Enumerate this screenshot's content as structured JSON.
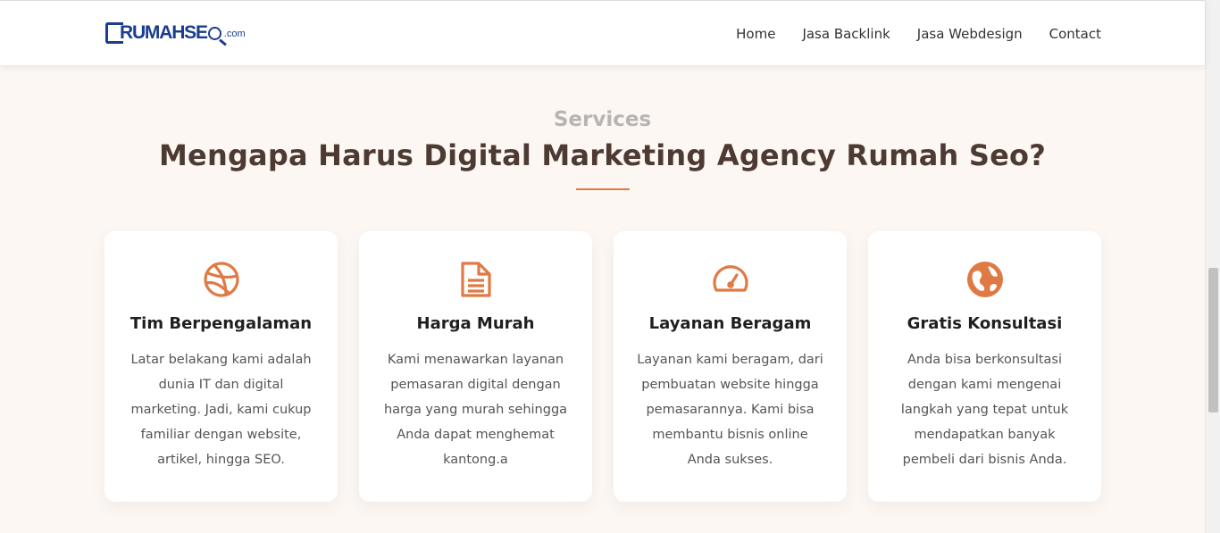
{
  "header": {
    "logo": {
      "main": "RUMAHSE",
      "suffix": ".com"
    },
    "nav": [
      {
        "label": "Home"
      },
      {
        "label": "Jasa Backlink"
      },
      {
        "label": "Jasa Webdesign"
      },
      {
        "label": "Contact"
      }
    ]
  },
  "section": {
    "kicker": "Services",
    "title": "Mengapa Harus Digital Marketing Agency Rumah Seo?"
  },
  "cards": [
    {
      "icon": "basketball-icon",
      "title": "Tim Berpengalaman",
      "text": "Latar belakang kami adalah dunia IT dan digital marketing. Jadi, kami cukup familiar dengan website, artikel, hingga SEO."
    },
    {
      "icon": "document-icon",
      "title": "Harga Murah",
      "text": "Kami menawarkan layanan pemasaran digital dengan harga yang murah sehingga Anda dapat menghemat kantong.a"
    },
    {
      "icon": "speedometer-icon",
      "title": "Layanan Beragam",
      "text": "Layanan kami beragam, dari pembuatan website hingga pemasarannya. Kami bisa membantu bisnis online Anda sukses."
    },
    {
      "icon": "globe-icon",
      "title": "Gratis Konsultasi",
      "text": "Anda bisa berkonsultasi dengan kami mengenai langkah yang tepat untuk mendapatkan banyak pembeli dari bisnis Anda."
    }
  ],
  "colors": {
    "accent": "#e07a45",
    "brand": "#1a3d8f",
    "title": "#4d3b33"
  }
}
